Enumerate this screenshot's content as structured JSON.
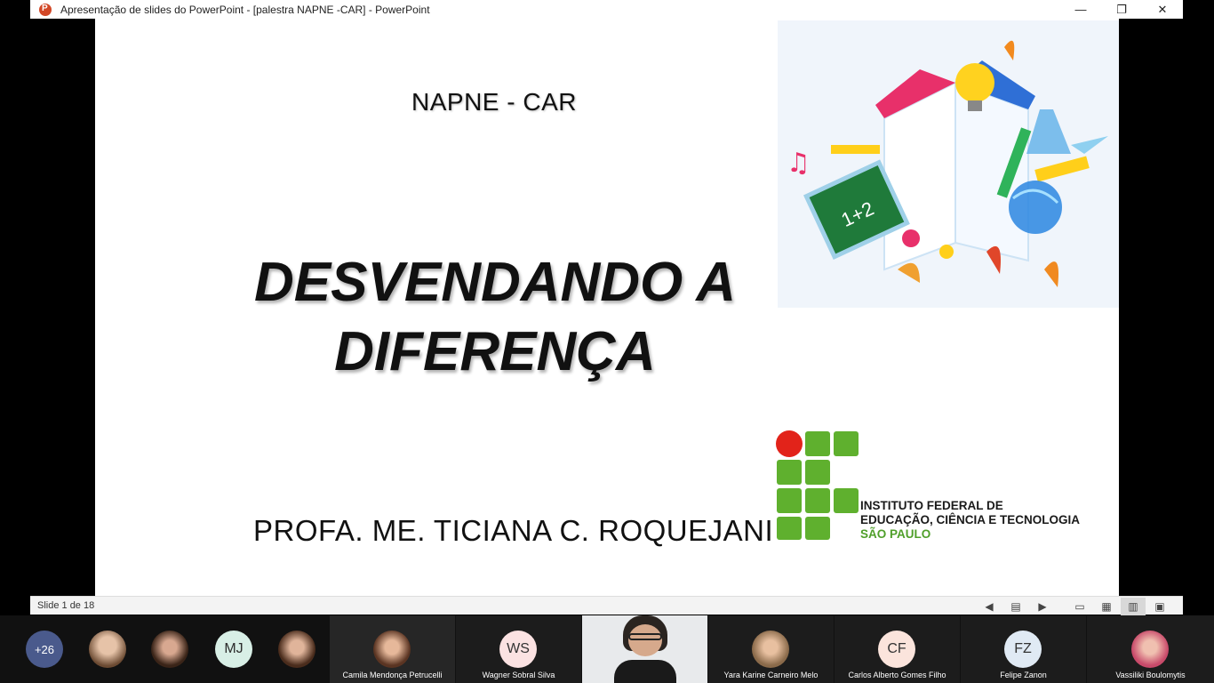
{
  "window": {
    "title": "Apresentação de slides do PowerPoint - [palestra NAPNE -CAR] - PowerPoint",
    "minimize": "—",
    "restore": "❐",
    "close": "✕"
  },
  "slide": {
    "heading": "NAPNE - CAR",
    "title_line1": "DESVENDANDO A",
    "title_line2": "DIFERENÇA",
    "author": "PROFA. ME. TICIANA C. ROQUEJANI",
    "artwork_text": "1+2",
    "institute_line1": "INSTITUTO FEDERAL DE",
    "institute_line2": "EDUCAÇÃO, CIÊNCIA E TECNOLOGIA",
    "institute_line3": "SÃO PAULO"
  },
  "statusbar": {
    "slide_counter": "Slide 1 de 18"
  },
  "participants": {
    "more_count": "+26",
    "mj_initials": "MJ",
    "camila_name": "Camila Mendonça Petrucelli",
    "wagner_initials": "WS",
    "wagner_name": "Wagner Sobral Silva",
    "yara_name": "Yara Karine Carneiro Melo",
    "carlos_initials": "CF",
    "carlos_name": "Carlos Alberto  Gomes Filho",
    "felipe_initials": "FZ",
    "felipe_name": "Felipe Zanon",
    "vassiliki_name": "Vassiliki Boulomytis"
  },
  "colors": {
    "if_green": "#4f9f2a",
    "if_red": "#e2231a",
    "ppt_orange": "#d24726"
  }
}
